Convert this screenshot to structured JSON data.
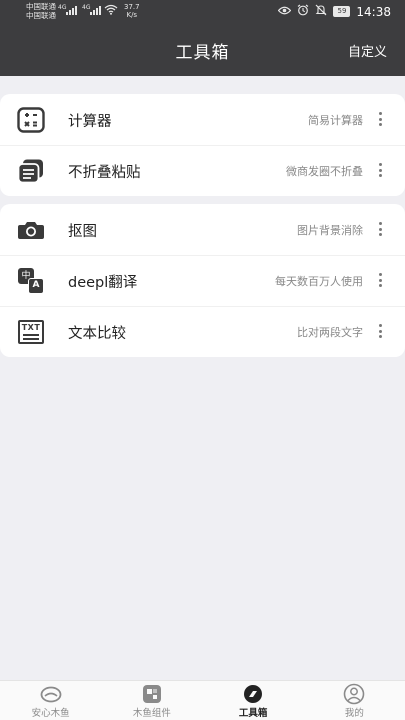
{
  "status_bar": {
    "carrier_1": "中国联通",
    "carrier_2": "中国联通",
    "network_1": "4G",
    "network_2": "4G",
    "speed_value": "37.7",
    "speed_unit": "K/s",
    "battery": "59",
    "time": "14:38"
  },
  "header": {
    "title": "工具箱",
    "action": "自定义"
  },
  "groups": [
    {
      "items": [
        {
          "icon": "calculator-icon",
          "label": "计算器",
          "desc": "简易计算器"
        },
        {
          "icon": "layers-icon",
          "label": "不折叠粘贴",
          "desc": "微商发圈不折叠"
        }
      ]
    },
    {
      "items": [
        {
          "icon": "camera-icon",
          "label": "抠图",
          "desc": "图片背景消除"
        },
        {
          "icon": "translate-icon",
          "label": "deepl翻译",
          "desc": "每天数百万人使用"
        },
        {
          "icon": "text-compare-icon",
          "label": "文本比较",
          "desc": "比对两段文字"
        }
      ]
    }
  ],
  "icon_text": {
    "translate_top": "中",
    "translate_bottom": "A",
    "text_compare": "TXT"
  },
  "bottom_nav": [
    {
      "label": "安心木鱼",
      "icon": "fish-icon",
      "active": false
    },
    {
      "label": "木鱼组件",
      "icon": "widget-icon",
      "active": false
    },
    {
      "label": "工具箱",
      "icon": "toolbox-icon",
      "active": true
    },
    {
      "label": "我的",
      "icon": "profile-icon",
      "active": false
    }
  ],
  "colors": {
    "header_bg": "#3d3d3f",
    "page_bg": "#efeff3",
    "active_text": "#222222",
    "inactive_text": "#8a8a8a"
  }
}
